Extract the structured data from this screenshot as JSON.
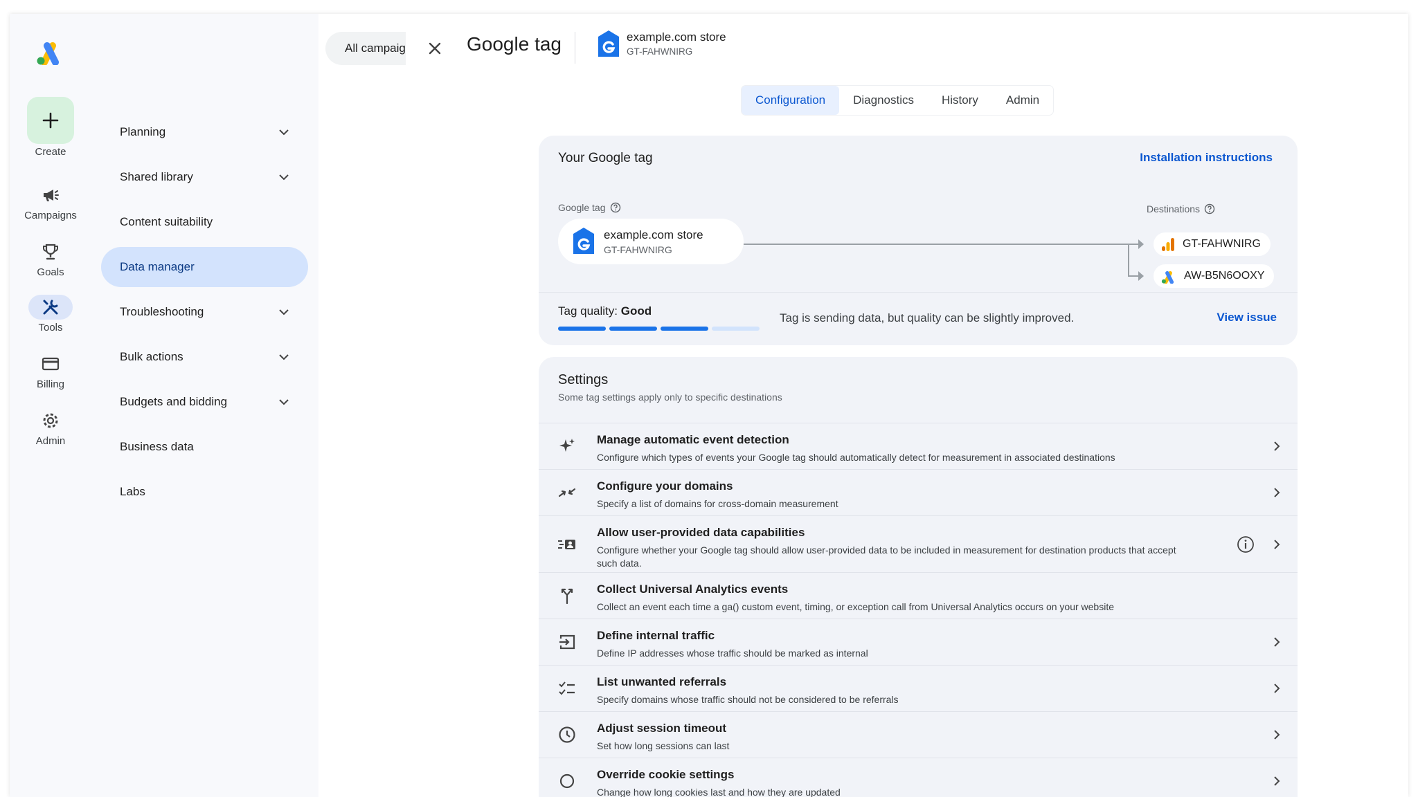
{
  "colors": {
    "accent": "#0b57d0",
    "nav_active_bg": "#d3e3fd",
    "create_bg": "#d7f2de",
    "card_bg": "#f1f3f8",
    "quality_bar": "#1a73e8",
    "quality_bar_empty": "#d2e3fc"
  },
  "rail": {
    "logo_icon": "google-ads-logo",
    "items": [
      {
        "label": "Create",
        "icon": "plus-icon"
      },
      {
        "label": "Campaigns",
        "icon": "megaphone-icon"
      },
      {
        "label": "Goals",
        "icon": "trophy-icon"
      },
      {
        "label": "Tools",
        "icon": "tools-icon",
        "active": true
      },
      {
        "label": "Billing",
        "icon": "credit-card-icon"
      },
      {
        "label": "Admin",
        "icon": "gear-icon"
      }
    ]
  },
  "nav": {
    "items": [
      {
        "label": "Planning",
        "expandable": true
      },
      {
        "label": "Shared library",
        "expandable": true
      },
      {
        "label": "Content suitability",
        "expandable": false
      },
      {
        "label": "Data manager",
        "expandable": false,
        "active": true
      },
      {
        "label": "Troubleshooting",
        "expandable": true
      },
      {
        "label": "Bulk actions",
        "expandable": true
      },
      {
        "label": "Budgets and bidding",
        "expandable": true
      },
      {
        "label": "Business data",
        "expandable": false
      },
      {
        "label": "Labs",
        "expandable": false
      }
    ]
  },
  "header": {
    "campaign_selector": "All campaigns",
    "title": "Google tag",
    "store_name": "example.com store",
    "store_id": "GT-FAHWNIRG"
  },
  "tabs": [
    {
      "label": "Configuration",
      "active": true
    },
    {
      "label": "Diagnostics"
    },
    {
      "label": "History"
    },
    {
      "label": "Admin"
    }
  ],
  "tag_card": {
    "title": "Your Google tag",
    "install_link": "Installation instructions",
    "google_tag_label": "Google tag",
    "destinations_label": "Destinations",
    "tag_name": "example.com store",
    "tag_id": "GT-FAHWNIRG",
    "destinations": [
      {
        "id": "GT-FAHWNIRG",
        "icon": "google-analytics-icon"
      },
      {
        "id": "AW-B5N6OOXY",
        "icon": "google-ads-icon"
      }
    ],
    "quality_prefix": "Tag quality:",
    "quality_value": "Good",
    "quality_level": 0.75,
    "quality_message": "Tag is sending data, but quality can be slightly improved.",
    "view_issue": "View issue"
  },
  "settings": {
    "title": "Settings",
    "subtitle": "Some tag settings apply only to specific destinations",
    "items": [
      {
        "title": "Manage automatic event detection",
        "desc": "Configure which types of events your Google tag should automatically detect for measurement in associated destinations",
        "icon": "sparkle-icon"
      },
      {
        "title": "Configure your domains",
        "desc": "Specify a list of domains for cross-domain measurement",
        "icon": "merge-arrows-icon"
      },
      {
        "title": "Allow user-provided data capabilities",
        "desc": "Configure whether your Google tag should allow user-provided data to be included in measurement for destination products that accept such data.",
        "icon": "user-data-icon",
        "info": true
      },
      {
        "title": "Collect Universal Analytics events",
        "desc": "Collect an event each time a ga() custom event, timing, or exception call from Universal Analytics occurs on your website",
        "icon": "fork-icon",
        "no_chevron": true
      },
      {
        "title": "Define internal traffic",
        "desc": "Define IP addresses whose traffic should be marked as internal",
        "icon": "login-box-icon"
      },
      {
        "title": "List unwanted referrals",
        "desc": "Specify domains whose traffic should not be considered to be referrals",
        "icon": "checklist-icon"
      },
      {
        "title": "Adjust session timeout",
        "desc": "Set how long sessions can last",
        "icon": "clock-icon"
      },
      {
        "title": "Override cookie settings",
        "desc": "Change how long cookies last and how they are updated",
        "icon": "circle-icon"
      }
    ]
  }
}
